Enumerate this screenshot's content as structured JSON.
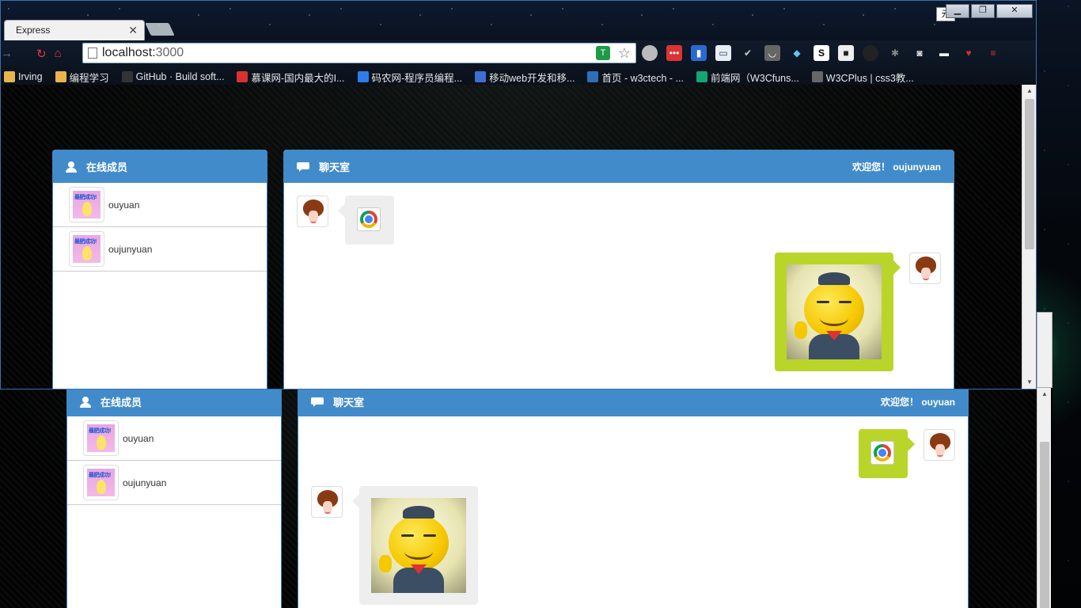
{
  "window_top": {
    "tab_title": "Express",
    "ime_label": "元",
    "url_host": "localhost:",
    "url_port": "3000",
    "bookmarks": [
      {
        "label": "Irving",
        "icon": "folder-icon",
        "color": "#e9b44c"
      },
      {
        "label": "编程学习",
        "icon": "folder-icon",
        "color": "#e9b44c"
      },
      {
        "label": "GitHub · Build soft...",
        "icon": "github-icon",
        "color": "#333333"
      },
      {
        "label": "慕课网-国内最大的I...",
        "icon": "imooc-icon",
        "color": "#d9312f"
      },
      {
        "label": "码农网-程序员编程...",
        "icon": "codeceo-icon",
        "color": "#2b7de9"
      },
      {
        "label": "移动web开发和移...",
        "icon": "mobile-web-icon",
        "color": "#3e6fd0"
      },
      {
        "label": "首页 - w3ctech - ...",
        "icon": "w3ctech-icon",
        "color": "#2f6fb8"
      },
      {
        "label": "前端网（W3Cfuns...",
        "icon": "w3cfuns-icon",
        "color": "#12a673"
      },
      {
        "label": "W3CPlus | css3教...",
        "icon": "w3cplus-icon",
        "color": "#666666"
      }
    ],
    "members_title": "在线成员",
    "chat_title": "聊天室",
    "welcome": "欢迎您！ oujunyuan",
    "members": [
      "ouyuan",
      "oujunyuan"
    ]
  },
  "window_bottom": {
    "members_title": "在线成员",
    "chat_title": "聊天室",
    "welcome": "欢迎您！ ouyuan",
    "members": [
      "ouyuan",
      "oujunyuan"
    ]
  },
  "colors": {
    "panel_header": "#428bca",
    "own_bubble": "#bad52a",
    "other_bubble": "#eeeeee"
  }
}
